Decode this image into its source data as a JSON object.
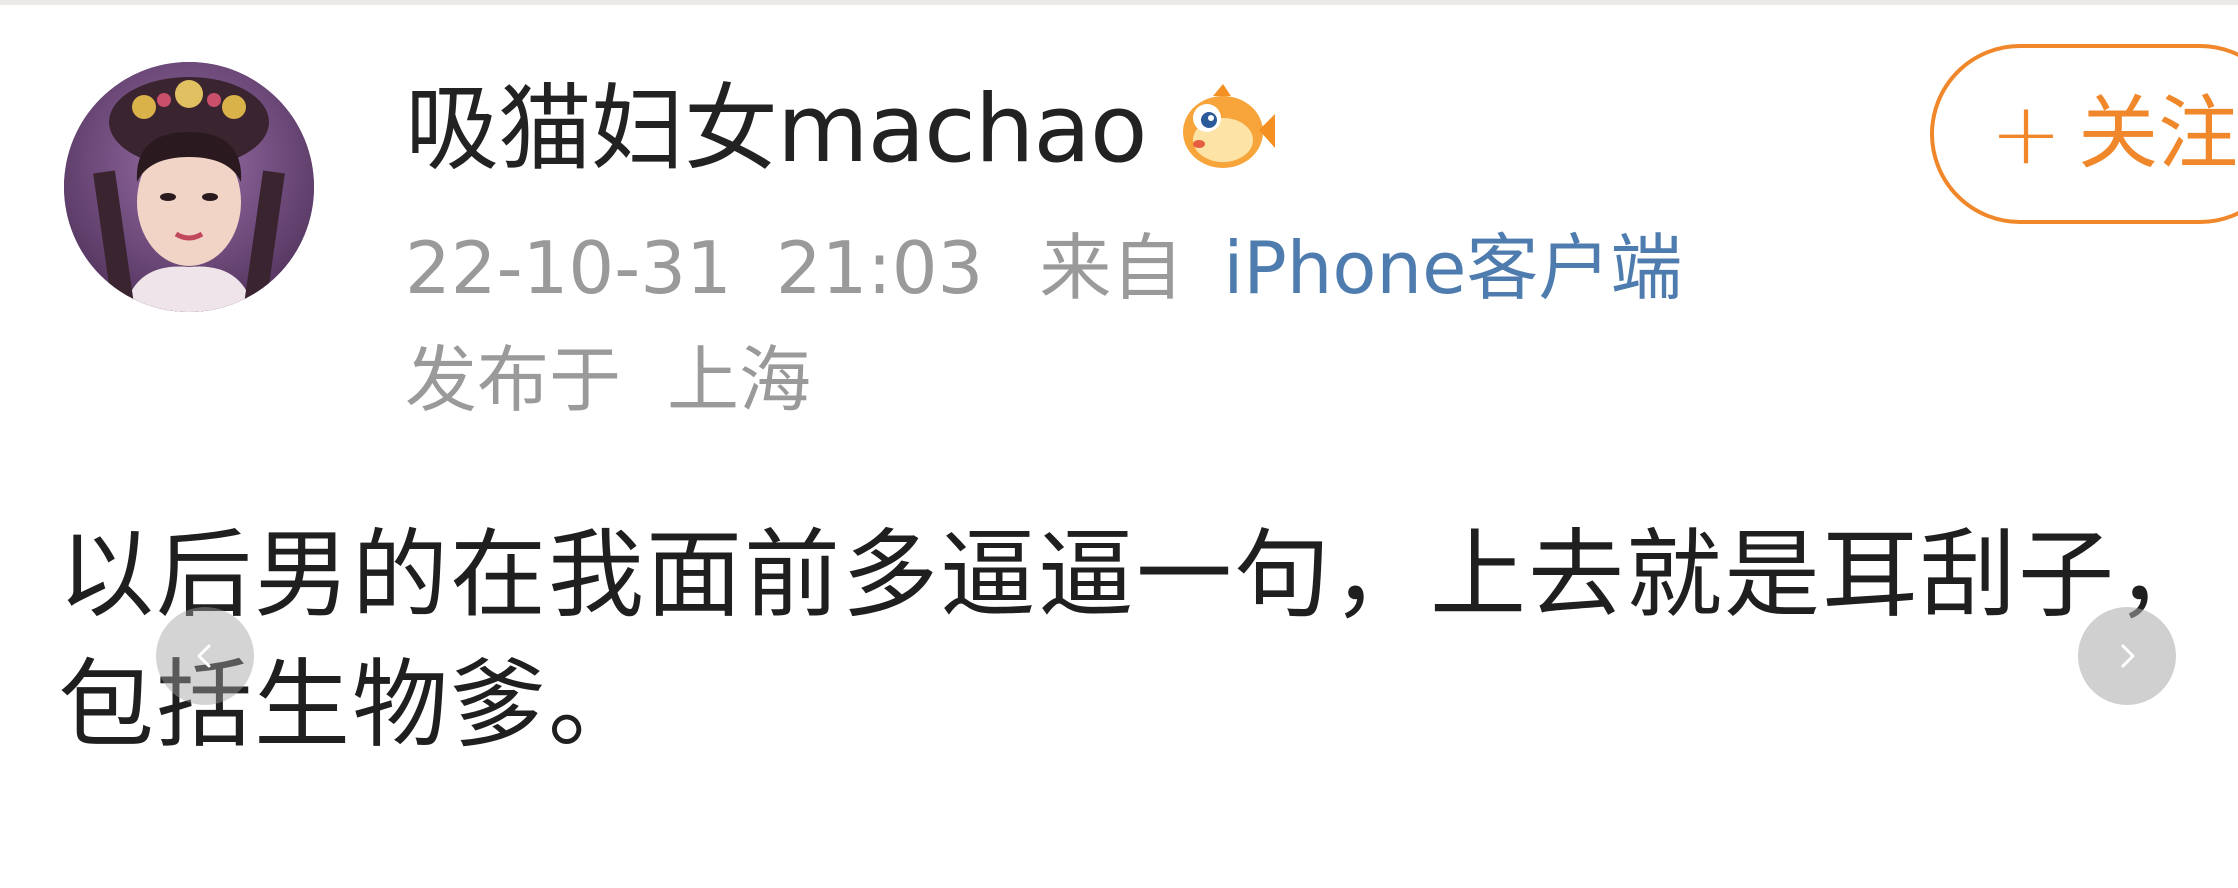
{
  "post": {
    "username": "吸猫妇女machao",
    "badge_icon": "pufferfish-badge-icon",
    "follow_plus": "+",
    "follow_label": "关注",
    "date": "22-10-31",
    "time": "21:03",
    "from_label": "来自",
    "source": "iPhone客户端",
    "location_prefix": "发布于",
    "location": "上海",
    "text_line1": "以后男的在我面前多逼逼一句，上去就是耳刮子，",
    "text_line2": "包括生物爹。"
  },
  "colors": {
    "accent": "#f0872a",
    "link": "#4f7cae",
    "meta": "#9a9a9a",
    "text": "#1f1f1f"
  }
}
